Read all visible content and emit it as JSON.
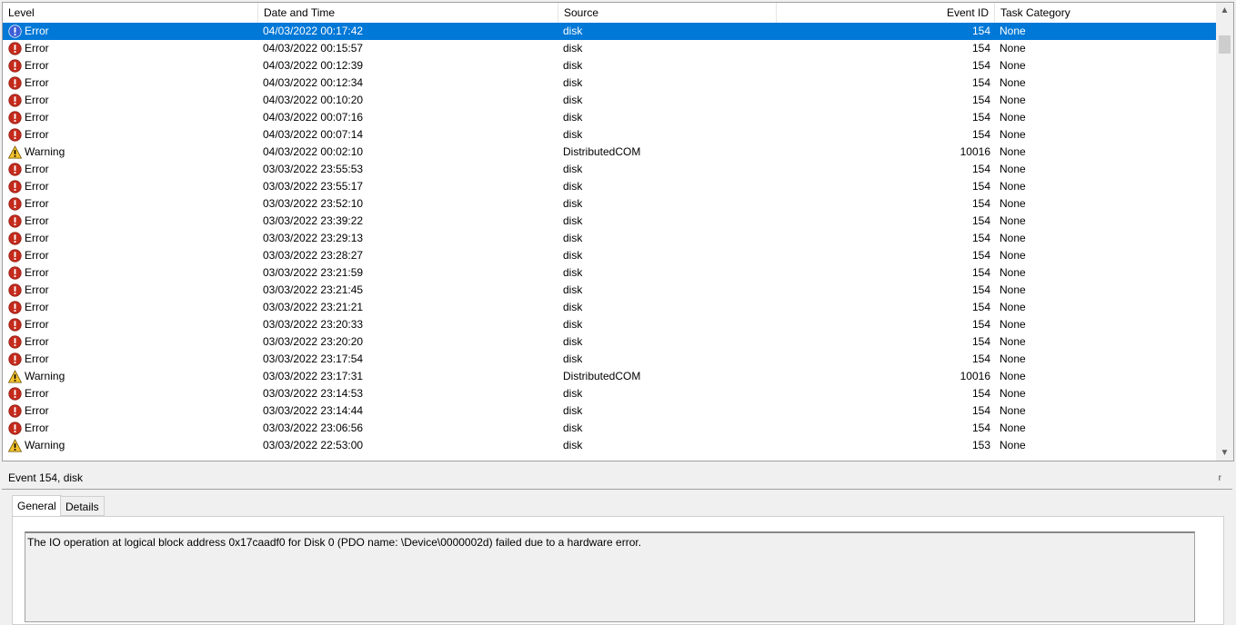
{
  "columns": {
    "level": "Level",
    "datetime": "Date and Time",
    "source": "Source",
    "event_id": "Event ID",
    "task_category": "Task Category"
  },
  "rows": [
    {
      "level": "Error",
      "datetime": "04/03/2022 00:17:42",
      "source": "disk",
      "event_id": "154",
      "task_category": "None",
      "icon": "error-icon"
    },
    {
      "level": "Error",
      "datetime": "04/03/2022 00:15:57",
      "source": "disk",
      "event_id": "154",
      "task_category": "None",
      "icon": "error-icon"
    },
    {
      "level": "Error",
      "datetime": "04/03/2022 00:12:39",
      "source": "disk",
      "event_id": "154",
      "task_category": "None",
      "icon": "error-icon"
    },
    {
      "level": "Error",
      "datetime": "04/03/2022 00:12:34",
      "source": "disk",
      "event_id": "154",
      "task_category": "None",
      "icon": "error-icon"
    },
    {
      "level": "Error",
      "datetime": "04/03/2022 00:10:20",
      "source": "disk",
      "event_id": "154",
      "task_category": "None",
      "icon": "error-icon"
    },
    {
      "level": "Error",
      "datetime": "04/03/2022 00:07:16",
      "source": "disk",
      "event_id": "154",
      "task_category": "None",
      "icon": "error-icon"
    },
    {
      "level": "Error",
      "datetime": "04/03/2022 00:07:14",
      "source": "disk",
      "event_id": "154",
      "task_category": "None",
      "icon": "error-icon"
    },
    {
      "level": "Warning",
      "datetime": "04/03/2022 00:02:10",
      "source": "DistributedCOM",
      "event_id": "10016",
      "task_category": "None",
      "icon": "warning-icon"
    },
    {
      "level": "Error",
      "datetime": "03/03/2022 23:55:53",
      "source": "disk",
      "event_id": "154",
      "task_category": "None",
      "icon": "error-icon"
    },
    {
      "level": "Error",
      "datetime": "03/03/2022 23:55:17",
      "source": "disk",
      "event_id": "154",
      "task_category": "None",
      "icon": "error-icon"
    },
    {
      "level": "Error",
      "datetime": "03/03/2022 23:52:10",
      "source": "disk",
      "event_id": "154",
      "task_category": "None",
      "icon": "error-icon"
    },
    {
      "level": "Error",
      "datetime": "03/03/2022 23:39:22",
      "source": "disk",
      "event_id": "154",
      "task_category": "None",
      "icon": "error-icon"
    },
    {
      "level": "Error",
      "datetime": "03/03/2022 23:29:13",
      "source": "disk",
      "event_id": "154",
      "task_category": "None",
      "icon": "error-icon"
    },
    {
      "level": "Error",
      "datetime": "03/03/2022 23:28:27",
      "source": "disk",
      "event_id": "154",
      "task_category": "None",
      "icon": "error-icon"
    },
    {
      "level": "Error",
      "datetime": "03/03/2022 23:21:59",
      "source": "disk",
      "event_id": "154",
      "task_category": "None",
      "icon": "error-icon"
    },
    {
      "level": "Error",
      "datetime": "03/03/2022 23:21:45",
      "source": "disk",
      "event_id": "154",
      "task_category": "None",
      "icon": "error-icon"
    },
    {
      "level": "Error",
      "datetime": "03/03/2022 23:21:21",
      "source": "disk",
      "event_id": "154",
      "task_category": "None",
      "icon": "error-icon"
    },
    {
      "level": "Error",
      "datetime": "03/03/2022 23:20:33",
      "source": "disk",
      "event_id": "154",
      "task_category": "None",
      "icon": "error-icon"
    },
    {
      "level": "Error",
      "datetime": "03/03/2022 23:20:20",
      "source": "disk",
      "event_id": "154",
      "task_category": "None",
      "icon": "error-icon"
    },
    {
      "level": "Error",
      "datetime": "03/03/2022 23:17:54",
      "source": "disk",
      "event_id": "154",
      "task_category": "None",
      "icon": "error-icon"
    },
    {
      "level": "Warning",
      "datetime": "03/03/2022 23:17:31",
      "source": "DistributedCOM",
      "event_id": "10016",
      "task_category": "None",
      "icon": "warning-icon"
    },
    {
      "level": "Error",
      "datetime": "03/03/2022 23:14:53",
      "source": "disk",
      "event_id": "154",
      "task_category": "None",
      "icon": "error-icon"
    },
    {
      "level": "Error",
      "datetime": "03/03/2022 23:14:44",
      "source": "disk",
      "event_id": "154",
      "task_category": "None",
      "icon": "error-icon"
    },
    {
      "level": "Error",
      "datetime": "03/03/2022 23:06:56",
      "source": "disk",
      "event_id": "154",
      "task_category": "None",
      "icon": "error-icon"
    },
    {
      "level": "Warning",
      "datetime": "03/03/2022 22:53:00",
      "source": "disk",
      "event_id": "153",
      "task_category": "None",
      "icon": "warning-icon"
    }
  ],
  "selected_row": 0,
  "detail": {
    "title": "Event 154, disk",
    "close_glyph": "r",
    "tabs": [
      "General",
      "Details"
    ],
    "active_tab": 0,
    "description": "The IO operation at logical block address 0x17caadf0 for Disk 0 (PDO name: \\Device\\0000002d) failed due to a hardware error."
  },
  "colors": {
    "selection": "#0078d7",
    "error": "#c42b1c",
    "warning": "#f2c12e"
  }
}
